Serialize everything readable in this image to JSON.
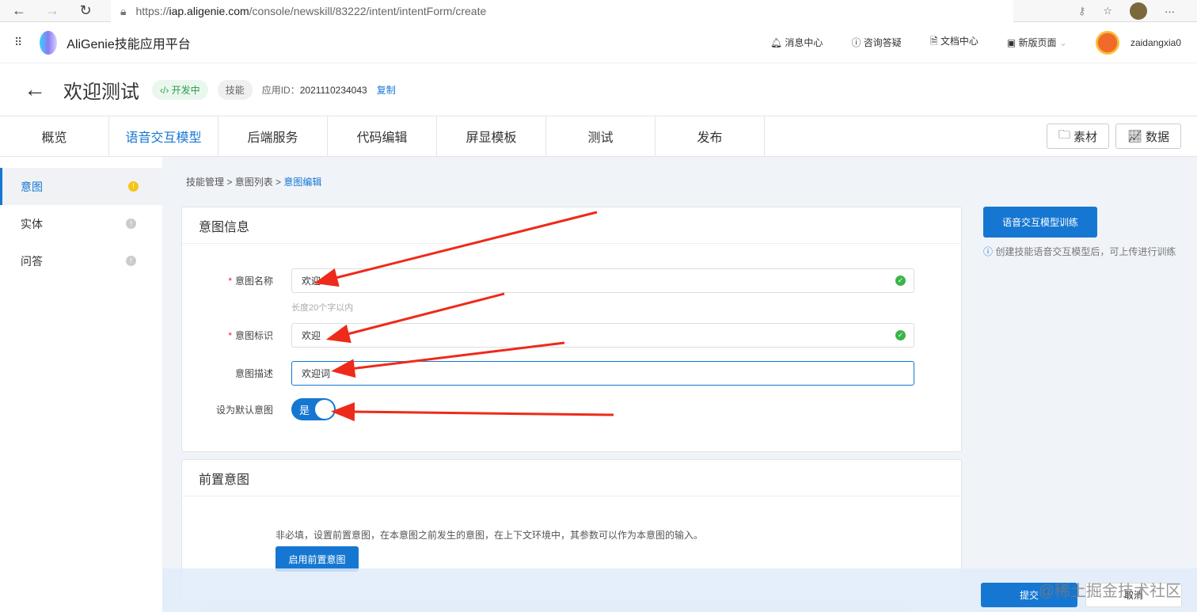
{
  "browser": {
    "url_prefix": "https://",
    "url_host": "iap.aligenie.com",
    "url_path": "/console/newskill/83222/intent/intentForm/create",
    "more": "···"
  },
  "topbar": {
    "brand": "AliGenie技能应用平台",
    "messages": "消息中心",
    "consult": "咨询答疑",
    "docs": "文档中心",
    "new_page": "新版页面",
    "username": "zaidangxia0"
  },
  "header": {
    "title": "欢迎测试",
    "status": "开发中",
    "type": "技能",
    "app_id_label": "应用ID：",
    "app_id": "2021110234043",
    "copy": "复制"
  },
  "tabs": [
    "概览",
    "语音交互模型",
    "后端服务",
    "代码编辑",
    "屏显模板",
    "测试",
    "发布"
  ],
  "tab_buttons": {
    "material": "素材",
    "data": "数据"
  },
  "sidebar": [
    {
      "label": "意图",
      "dot": "!"
    },
    {
      "label": "实体",
      "dot": "!"
    },
    {
      "label": "问答",
      "dot": "!"
    }
  ],
  "breadcrumb": [
    "技能管理",
    "意图列表",
    "意图编辑"
  ],
  "intent_info": {
    "title": "意图信息",
    "name_label": "意图名称",
    "name_value": "欢迎",
    "name_hint": "长度20个字以内",
    "id_label": "意图标识",
    "id_value": "欢迎",
    "desc_label": "意图描述",
    "desc_value": "欢迎词",
    "default_label": "设为默认意图",
    "default_value": "是"
  },
  "pre_intent": {
    "title": "前置意图",
    "desc": "非必填，设置前置意图，在本意图之前发生的意图，在上下文环境中，其参数可以作为本意图的输入。",
    "button": "启用前置意图"
  },
  "train": {
    "button": "语音交互模型训练",
    "hint": "创建技能语音交互模型后，可上传进行训练"
  },
  "footer": {
    "submit": "提交",
    "cancel": "取消"
  },
  "watermark": "@稀土掘金技术社区"
}
